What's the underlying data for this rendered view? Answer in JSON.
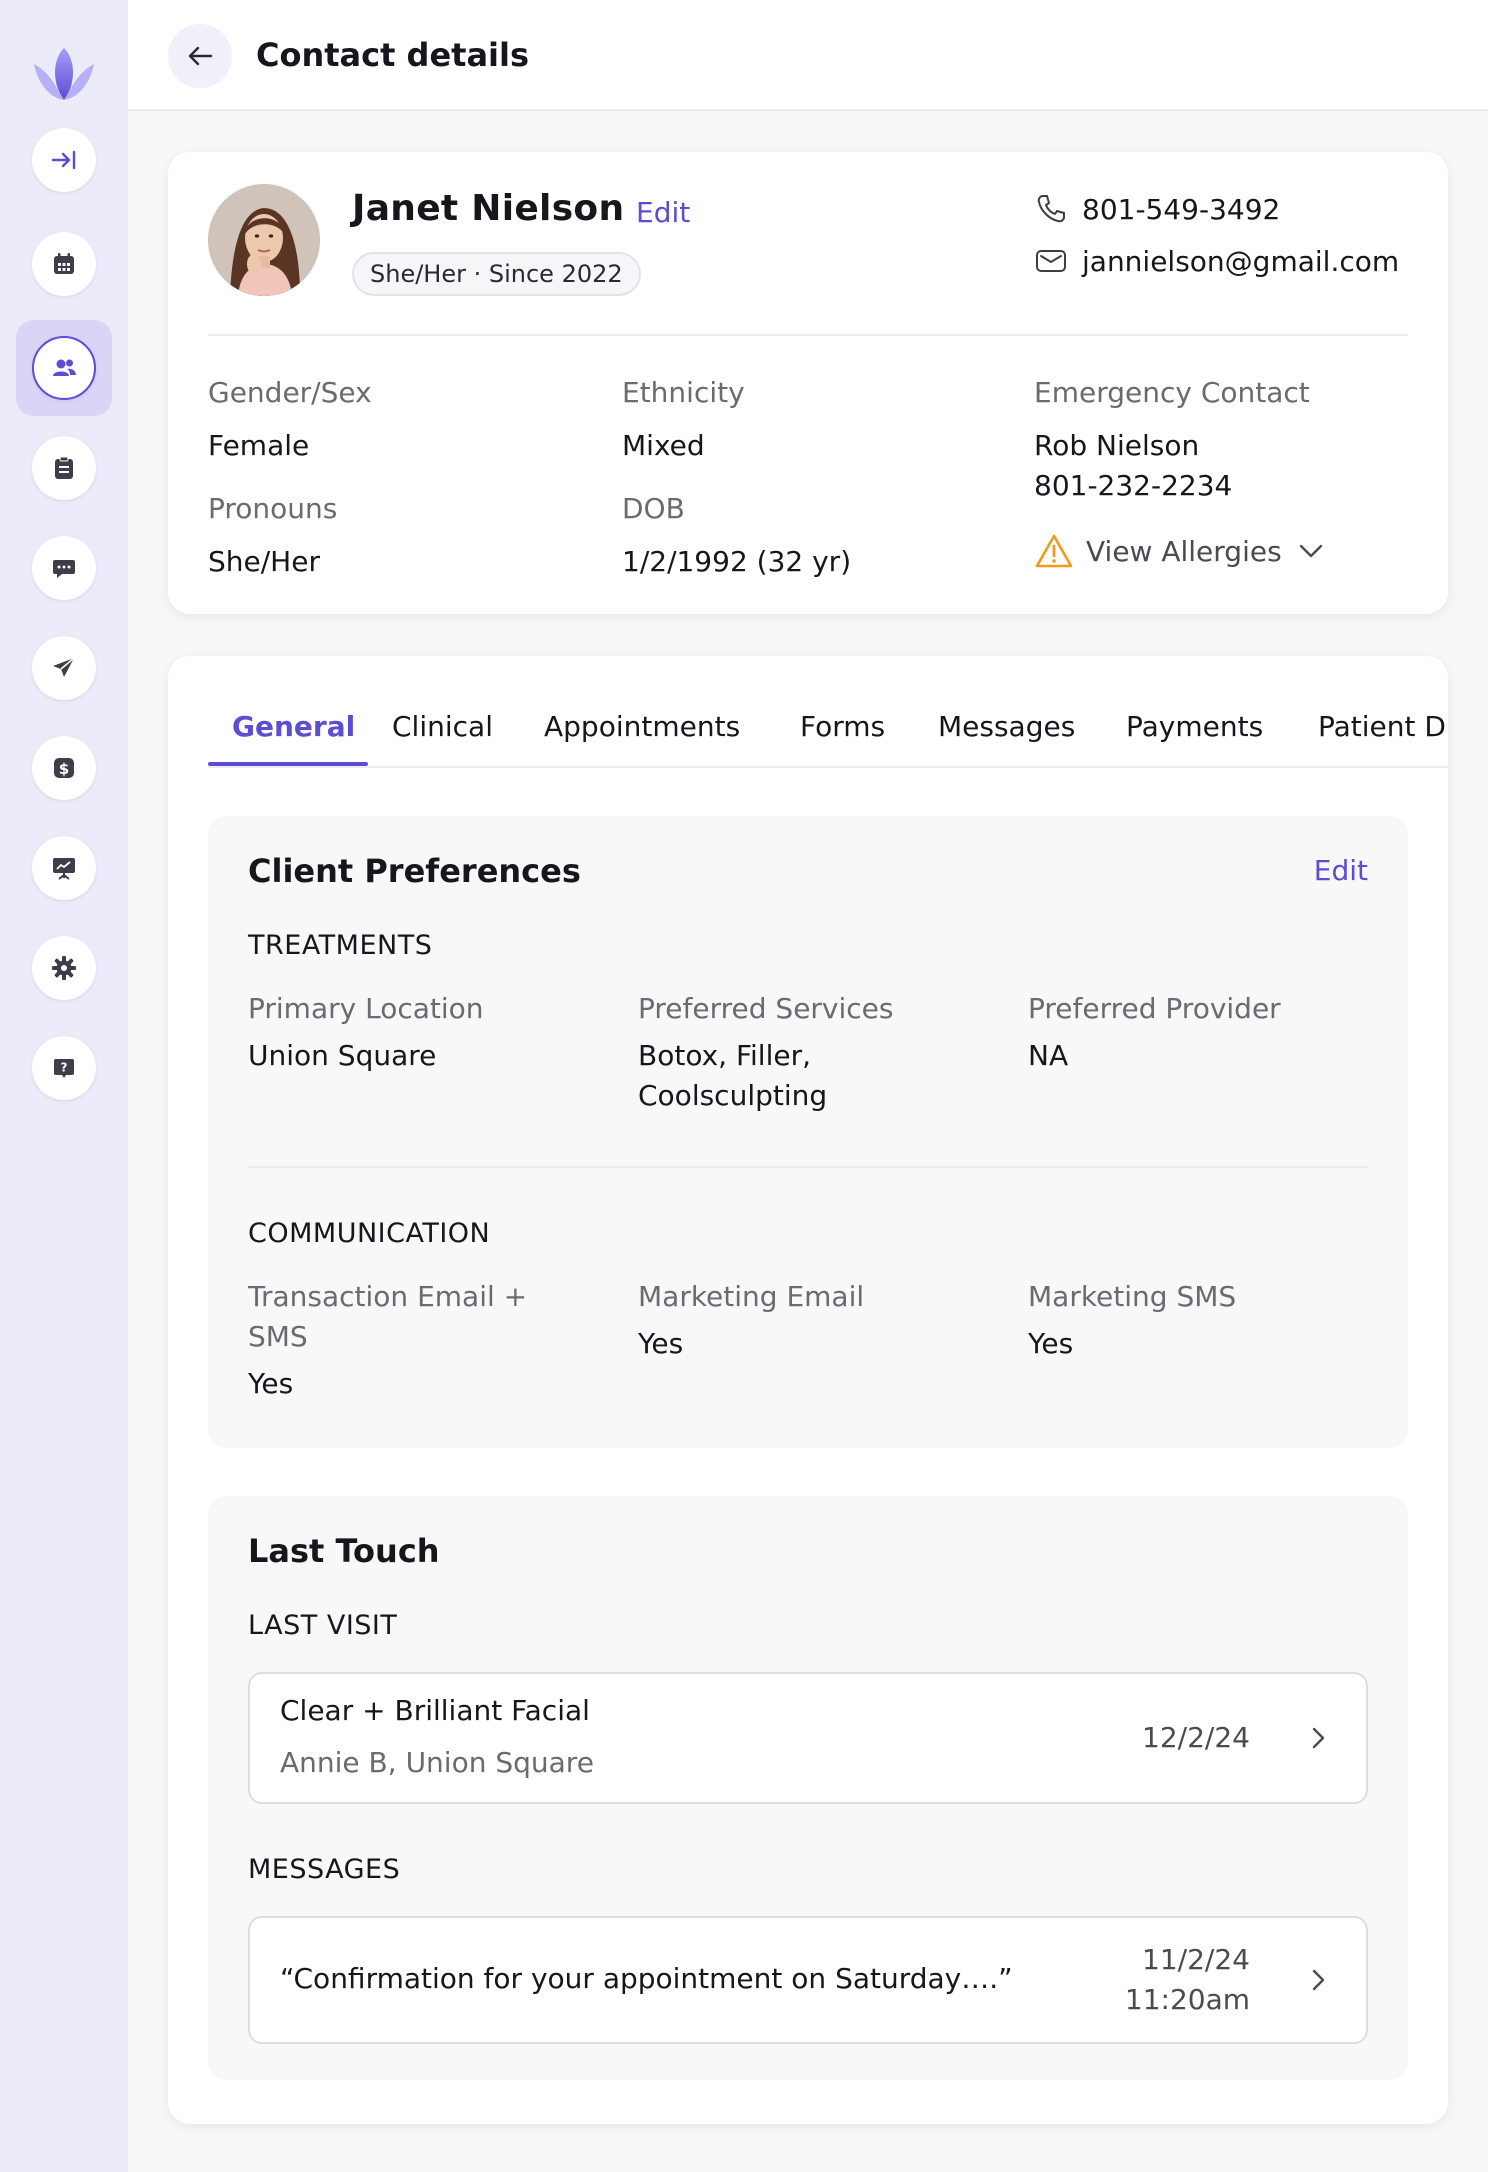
{
  "header": {
    "title": "Contact details"
  },
  "profile": {
    "name": "Janet Nielson",
    "edit_label": "Edit",
    "chip": "She/Her · Since 2022",
    "phone": "801-549-3492",
    "email": "jannielson@gmail.com",
    "fields": {
      "gender_label": "Gender/Sex",
      "gender_value": "Female",
      "ethnicity_label": "Ethnicity",
      "ethnicity_value": "Mixed",
      "emergency_label": "Emergency Contact",
      "emergency_name": "Rob Nielson",
      "emergency_phone": "801-232-2234",
      "pronouns_label": "Pronouns",
      "pronouns_value": "She/Her",
      "dob_label": "DOB",
      "dob_value": "1/2/1992 (32 yr)"
    },
    "allergies_label": "View Allergies"
  },
  "tabs": [
    {
      "label": "General"
    },
    {
      "label": "Clinical"
    },
    {
      "label": "Appointments"
    },
    {
      "label": "Forms"
    },
    {
      "label": "Messages"
    },
    {
      "label": "Payments"
    },
    {
      "label": "Patient D"
    }
  ],
  "preferences": {
    "title": "Client Preferences",
    "edit_label": "Edit",
    "treatments_head": "TREATMENTS",
    "primary_location_label": "Primary Location",
    "primary_location_value": "Union Square",
    "services_label": "Preferred Services",
    "services_line1": "Botox, Filler,",
    "services_line2": "Coolsculpting",
    "provider_label": "Preferred Provider",
    "provider_value": "NA",
    "communication_head": "COMMUNICATION",
    "transaction_label_line1": "Transaction Email +",
    "transaction_label_line2": "SMS",
    "transaction_value": "Yes",
    "marketing_email_label": "Marketing Email",
    "marketing_email_value": "Yes",
    "marketing_sms_label": "Marketing SMS",
    "marketing_sms_value": "Yes"
  },
  "last_touch": {
    "title": "Last Touch",
    "visit_head": "LAST VISIT",
    "visit_title": "Clear + Brilliant Facial",
    "visit_sub": "Annie B, Union Square",
    "visit_date": "12/2/24",
    "messages_head": "MESSAGES",
    "message_text": "“Confirmation for your appointment on Saturday….”",
    "message_date": "11/2/24",
    "message_time": "11:20am"
  },
  "colors": {
    "accent": "#5b4dd6",
    "sidebar_bg": "#ecebfa",
    "warning": "#f29a1f"
  }
}
